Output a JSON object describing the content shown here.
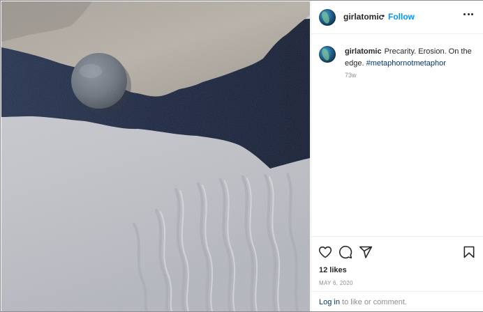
{
  "post": {
    "username": "girlatomic",
    "separator": "•",
    "follow_label": "Follow",
    "more_icon": "more-options-icon",
    "image_alt": "Photo of a grey pebble on a sand ledge above rippled sand"
  },
  "caption": {
    "username": "girlatomic",
    "text": "Precarity. Erosion. On the edge.",
    "hashtag": "#metaphornotmetaphor",
    "age": "73w"
  },
  "actions": {
    "icons": [
      "heart-icon",
      "comment-icon",
      "share-icon",
      "bookmark-icon"
    ]
  },
  "likes": "12 likes",
  "date": "MAY 6, 2020",
  "login": {
    "link": "Log in",
    "rest": "to like or comment."
  },
  "colors": {
    "link_blue": "#0095f6",
    "hashtag_blue": "#00376b",
    "text": "#262626",
    "muted": "#8e8e8e",
    "divider": "#efefef"
  }
}
